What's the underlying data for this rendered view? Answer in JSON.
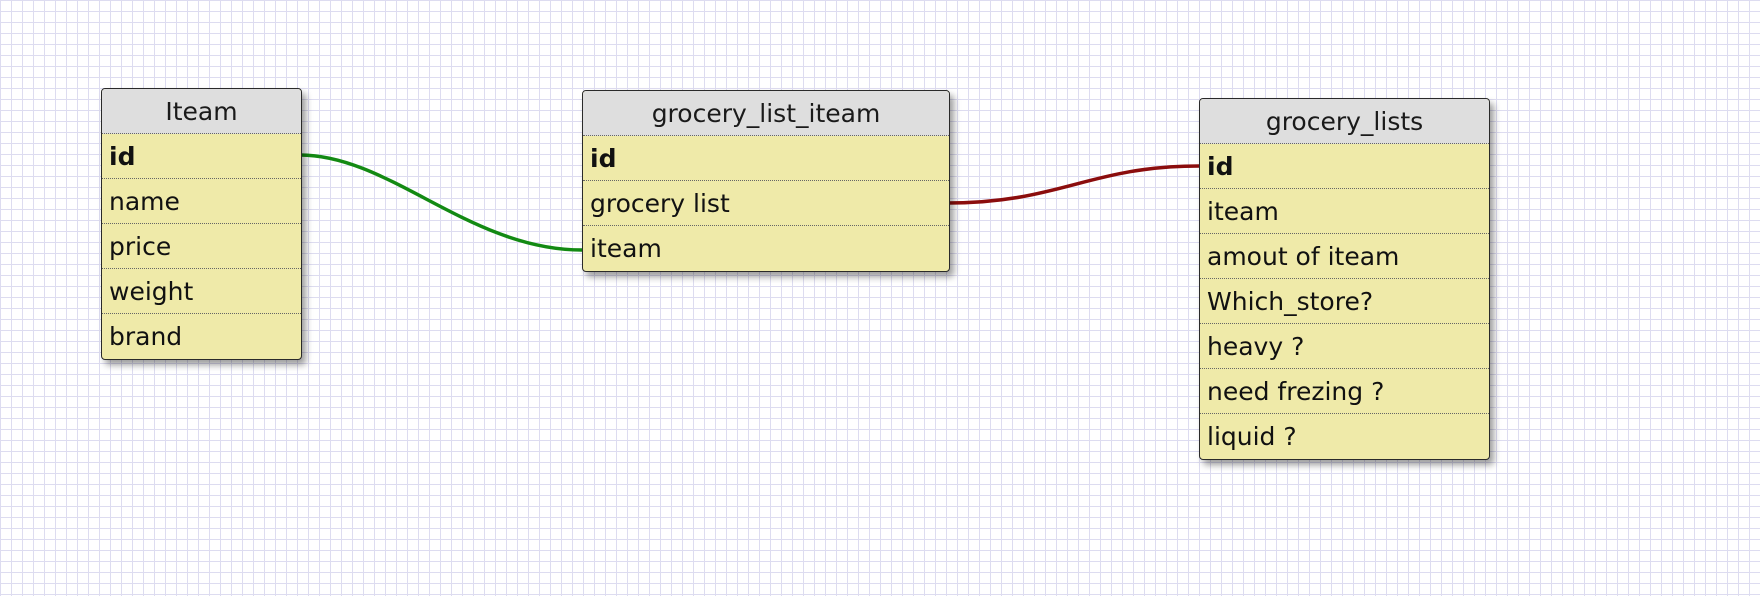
{
  "tables": {
    "iteam": {
      "title": "Iteam",
      "fields": [
        "id",
        "name",
        "price",
        "weight",
        "brand"
      ]
    },
    "grocery_list_iteam": {
      "title": "grocery_list_iteam",
      "fields": [
        "id",
        "grocery list",
        "iteam"
      ]
    },
    "grocery_lists": {
      "title": "grocery_lists",
      "fields": [
        "id",
        "iteam",
        "amout of iteam",
        "Which_store?",
        "heavy ?",
        "need frezing ?",
        "liquid ?"
      ]
    }
  },
  "relations": [
    {
      "from": "Iteam.id",
      "to": "grocery_list_iteam.iteam",
      "color": "#138a13"
    },
    {
      "from": "grocery_list_iteam.grocery list",
      "to": "grocery_lists.id",
      "color": "#8b0d0d"
    }
  ],
  "colors": {
    "table_body": "#efeaa9",
    "table_header": "#dedede",
    "grid_line": "#dddcf0"
  }
}
